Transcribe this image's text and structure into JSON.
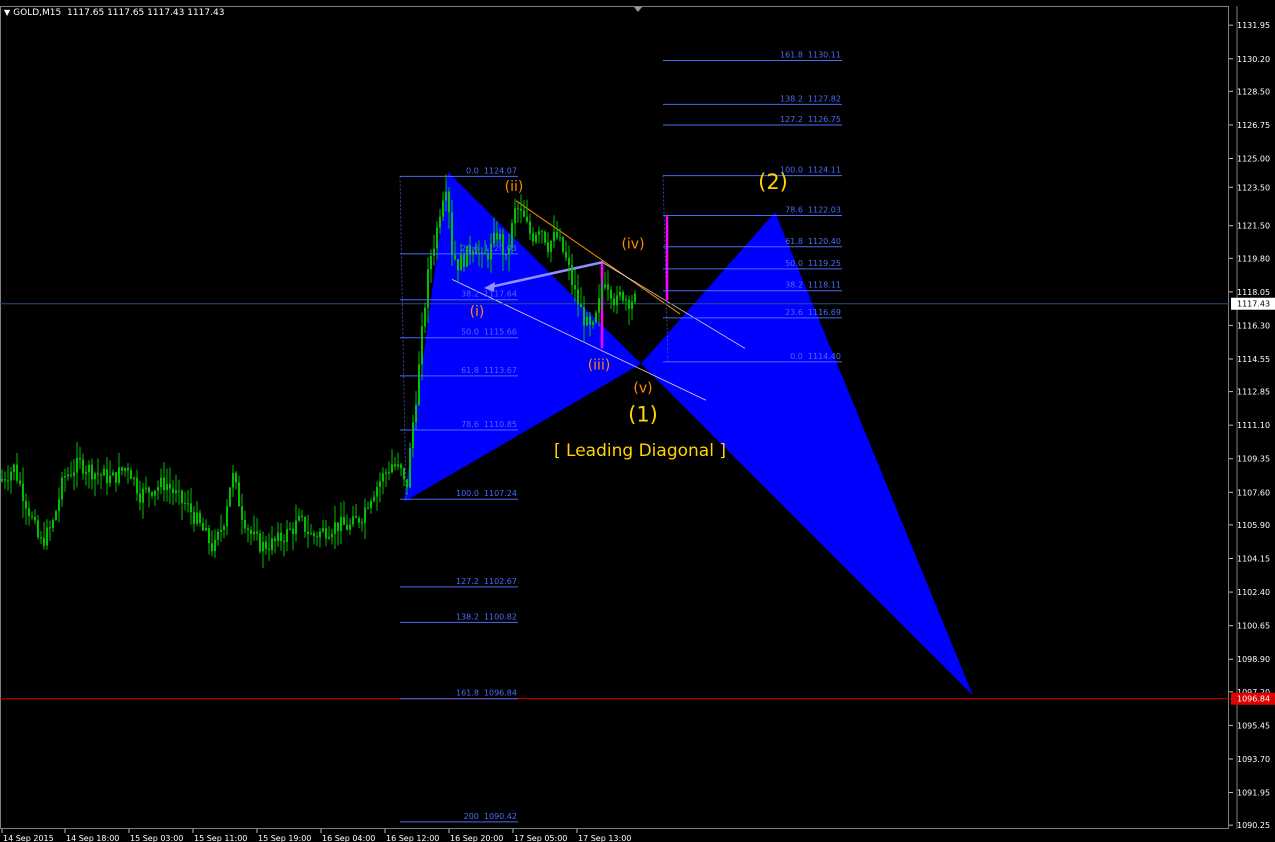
{
  "header": {
    "title": "GOLD,M15",
    "quote": "1117.65 1117.65 1117.43 1117.43"
  },
  "colors": {
    "background": "#000000",
    "candles": "#00c000",
    "fibo": "#4a6cf7",
    "harmonic_fill": "#0000ff",
    "wave_minor": "#ff8c00",
    "wave_major": "#ffd400",
    "current_price_line": "#2a4f7a",
    "target_line": "#e00000",
    "magenta": "#ff00ff"
  },
  "chart_data": {
    "type": "candlestick",
    "symbol": "GOLD",
    "timeframe": "M15",
    "ylim": [
      1090.05,
      1132.95
    ],
    "y_ticks": [
      "1131.95",
      "1130.20",
      "1128.50",
      "1126.75",
      "1125.00",
      "1123.50",
      "1121.50",
      "1119.80",
      "1118.05",
      "1116.30",
      "1114.55",
      "1112.85",
      "1111.10",
      "1109.35",
      "1107.60",
      "1105.90",
      "1104.15",
      "1102.40",
      "1100.65",
      "1098.90",
      "1097.20",
      "1095.45",
      "1093.70",
      "1091.95",
      "1090.25"
    ],
    "x_ticks": [
      "14 Sep 2015",
      "14 Sep 18:00",
      "15 Sep 03:00",
      "15 Sep 11:00",
      "15 Sep 19:00",
      "16 Sep 04:00",
      "16 Sep 12:00",
      "16 Sep 20:00",
      "17 Sep 05:00",
      "17 Sep 13:00"
    ],
    "current_price": "1117.43",
    "target_price": "1096.84",
    "fibo_left": [
      {
        "level": "0.0",
        "price": "1124.07"
      },
      {
        "level": "23.6",
        "price": "1120.03"
      },
      {
        "level": "38.2",
        "price": "1117.64"
      },
      {
        "level": "50.0",
        "price": "1115.66"
      },
      {
        "level": "61.8",
        "price": "1113.67"
      },
      {
        "level": "78.6",
        "price": "1110.85"
      },
      {
        "level": "100.0",
        "price": "1107.24"
      },
      {
        "level": "127.2",
        "price": "1102.67"
      },
      {
        "level": "138.2",
        "price": "1100.82"
      },
      {
        "level": "161.8",
        "price": "1096.84"
      },
      {
        "level": "200",
        "price": "1090.42"
      }
    ],
    "fibo_right": [
      {
        "level": "161.8",
        "price": "1130.11"
      },
      {
        "level": "138.2",
        "price": "1127.82"
      },
      {
        "level": "127.2",
        "price": "1126.75"
      },
      {
        "level": "100.0",
        "price": "1124.11"
      },
      {
        "level": "78.6",
        "price": "1122.03"
      },
      {
        "level": "61.8",
        "price": "1120.40"
      },
      {
        "level": "50.0",
        "price": "1119.25"
      },
      {
        "level": "38.2",
        "price": "1118.11"
      },
      {
        "level": "23.6",
        "price": "1116.69"
      },
      {
        "level": "0.0",
        "price": "1114.40"
      }
    ],
    "wave_labels_minor": [
      "(i)",
      "(ii)",
      "(iii)",
      "(iv)",
      "(v)"
    ],
    "wave_labels_major": [
      "(1)",
      "(2)"
    ],
    "annotation": "[ Leading Diagonal ]"
  }
}
